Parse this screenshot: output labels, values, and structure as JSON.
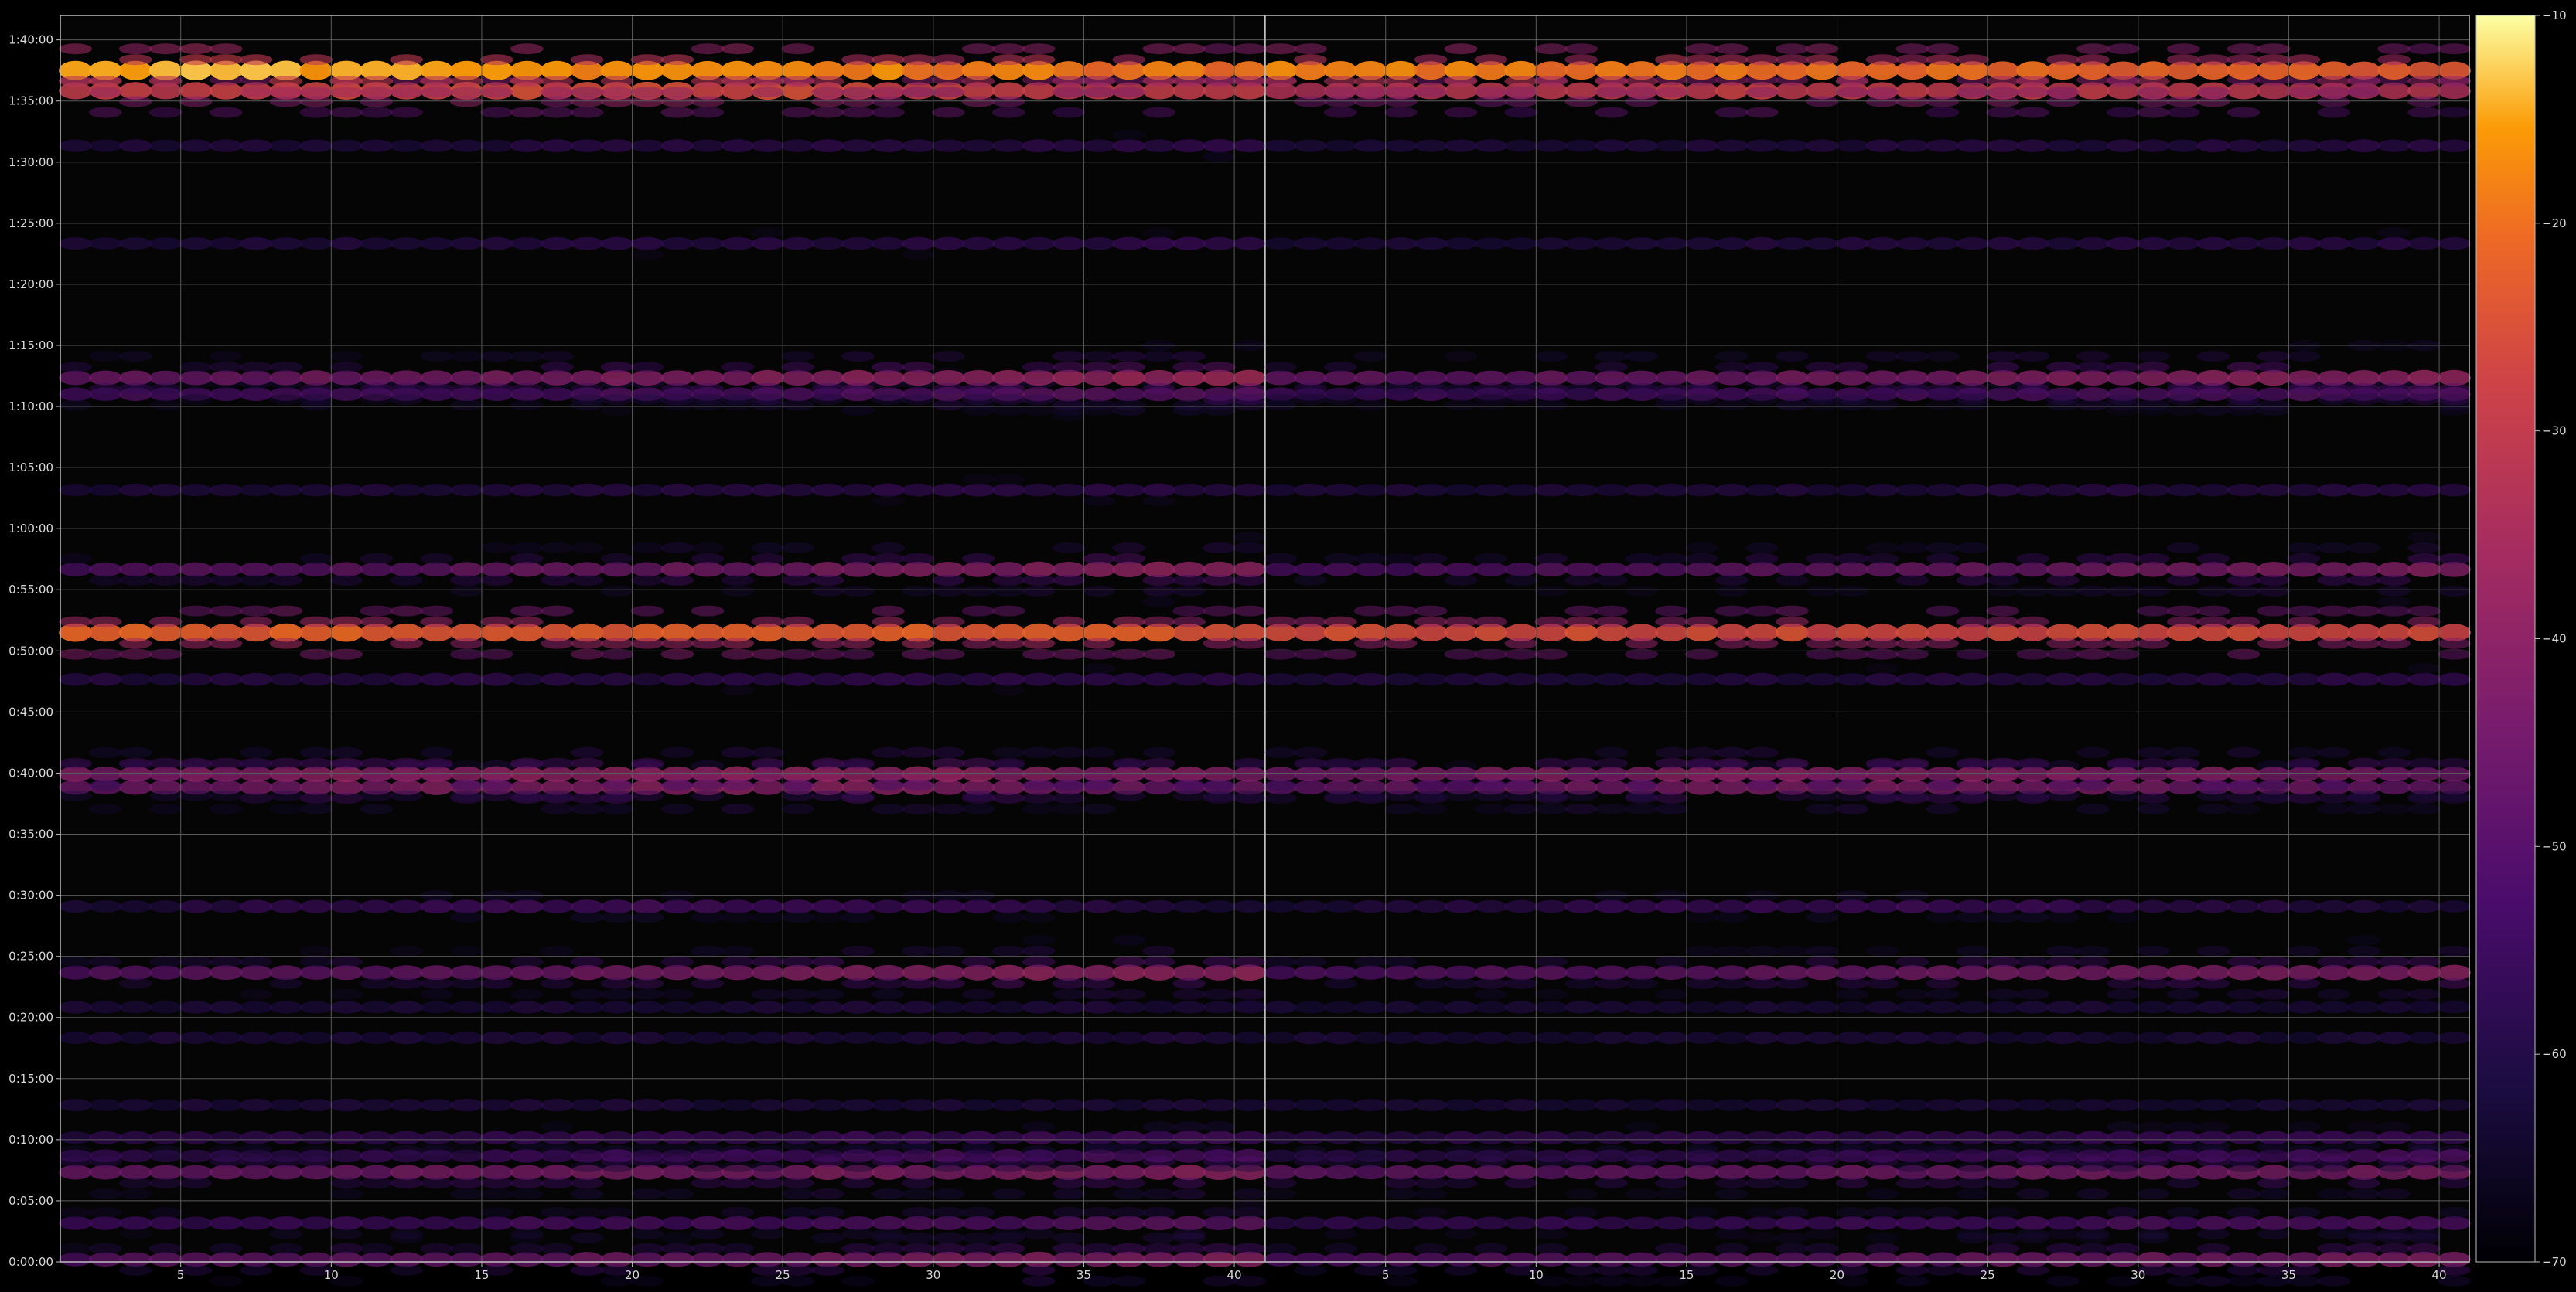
{
  "chart_data": {
    "type": "heatmap",
    "title": "",
    "xlabel": "",
    "ylabel": "",
    "background": "#050505",
    "grid": true,
    "colormap": "inferno",
    "panels": [
      {
        "name": "",
        "xlim": [
          1,
          40
        ],
        "xticks": [
          5,
          10,
          15,
          20,
          25,
          30,
          35,
          40
        ],
        "xtick_labels": [
          "5",
          "10",
          "15",
          "20",
          "25",
          "30",
          "35",
          "40"
        ]
      },
      {
        "name": "",
        "xlim": [
          1,
          40
        ],
        "xticks": [
          5,
          10,
          15,
          20,
          25,
          30,
          35,
          40
        ],
        "xtick_labels": [
          "5",
          "10",
          "15",
          "20",
          "25",
          "30",
          "35",
          "40"
        ]
      }
    ],
    "y_axis": {
      "unit": "seconds",
      "ylim": [
        0,
        6120
      ],
      "ticks": [
        0,
        300,
        600,
        900,
        1200,
        1500,
        1800,
        2100,
        2400,
        2700,
        3000,
        3300,
        3600,
        3900,
        4200,
        4500,
        4800,
        5100,
        5400,
        5700,
        6000
      ],
      "tick_labels": [
        "0:00:00",
        "0:05:00",
        "0:10:00",
        "0:15:00",
        "0:20:00",
        "0:25:00",
        "0:30:00",
        "0:35:00",
        "0:40:00",
        "0:45:00",
        "0:50:00",
        "0:55:00",
        "1:00:00",
        "1:05:00",
        "1:10:00",
        "1:15:00",
        "1:20:00",
        "1:25:00",
        "1:30:00",
        "1:35:00",
        "1:40:00"
      ]
    },
    "colorbar": {
      "range": [
        -70,
        -10
      ],
      "ticks": [
        -10,
        -20,
        -30,
        -40,
        -50,
        -60,
        -70
      ],
      "tick_labels": [
        "−10",
        "−20",
        "−30",
        "−40",
        "−50",
        "−60",
        "−70"
      ]
    },
    "value_range": [
      -70,
      -10
    ],
    "bands": [
      {
        "time": 12,
        "peak": -40,
        "floor": -55,
        "hint": "right",
        "grow": 0.45,
        "both": true
      },
      {
        "time": 190,
        "peak": -48,
        "floor": -60,
        "hint": "right",
        "grow": 0.3,
        "both": true
      },
      {
        "time": 440,
        "peak": -40,
        "floor": -50,
        "hint": "right",
        "grow": 0.35,
        "both": true
      },
      {
        "time": 520,
        "peak": -50,
        "floor": -62,
        "hint": "right",
        "grow": 0.3,
        "both": true
      },
      {
        "time": 610,
        "peak": -52,
        "floor": -60,
        "hint": "right",
        "grow": 0.3,
        "both": true
      },
      {
        "time": 770,
        "peak": -56,
        "floor": -60,
        "hint": "flat",
        "grow": 0.0,
        "both": true
      },
      {
        "time": 1100,
        "peak": -56,
        "floor": -60,
        "hint": "flat",
        "grow": 0.0,
        "both": true
      },
      {
        "time": 1250,
        "peak": -56,
        "floor": -60,
        "hint": "flat",
        "grow": 0.0,
        "both": true
      },
      {
        "time": 1420,
        "peak": -38,
        "floor": -56,
        "hint": "right",
        "grow": 0.35,
        "both": true
      },
      {
        "time": 1745,
        "peak": -52,
        "floor": -60,
        "hint": "middle",
        "grow": 0.0,
        "both": true
      },
      {
        "time": 2330,
        "peak": -40,
        "floor": -46,
        "hint": "middle",
        "grow": 0.0,
        "both": true
      },
      {
        "time": 2395,
        "peak": -38,
        "floor": -42,
        "hint": "middle",
        "grow": 0.0,
        "both": true
      },
      {
        "time": 2860,
        "peak": -56,
        "floor": -60,
        "hint": "right",
        "grow": 0.2,
        "both": true
      },
      {
        "time": 3090,
        "peak": -22,
        "floor": -25,
        "hint": "left",
        "grow": 0.0,
        "both": true
      },
      {
        "time": 3400,
        "peak": -38,
        "floor": -58,
        "hint": "right",
        "grow": 0.3,
        "both": true
      },
      {
        "time": 3790,
        "peak": -56,
        "floor": -62,
        "hint": "right",
        "grow": 0.2,
        "both": true
      },
      {
        "time": 4260,
        "peak": -48,
        "floor": -56,
        "hint": "right",
        "grow": 0.3,
        "both": true
      },
      {
        "time": 4340,
        "peak": -36,
        "floor": -52,
        "hint": "right",
        "grow": 0.3,
        "both": true
      },
      {
        "time": 5000,
        "peak": -56,
        "floor": -62,
        "hint": "right",
        "grow": 0.2,
        "both": true
      },
      {
        "time": 5480,
        "peak": -56,
        "floor": -62,
        "hint": "right",
        "grow": 0.2,
        "both": true
      },
      {
        "time": 5750,
        "peak": -26,
        "floor": -30,
        "hint": "middle",
        "grow": 0.0,
        "both": true
      },
      {
        "time": 5850,
        "peak": -14,
        "floor": -28,
        "hint": "left",
        "grow": 0.0,
        "both": true
      }
    ]
  }
}
